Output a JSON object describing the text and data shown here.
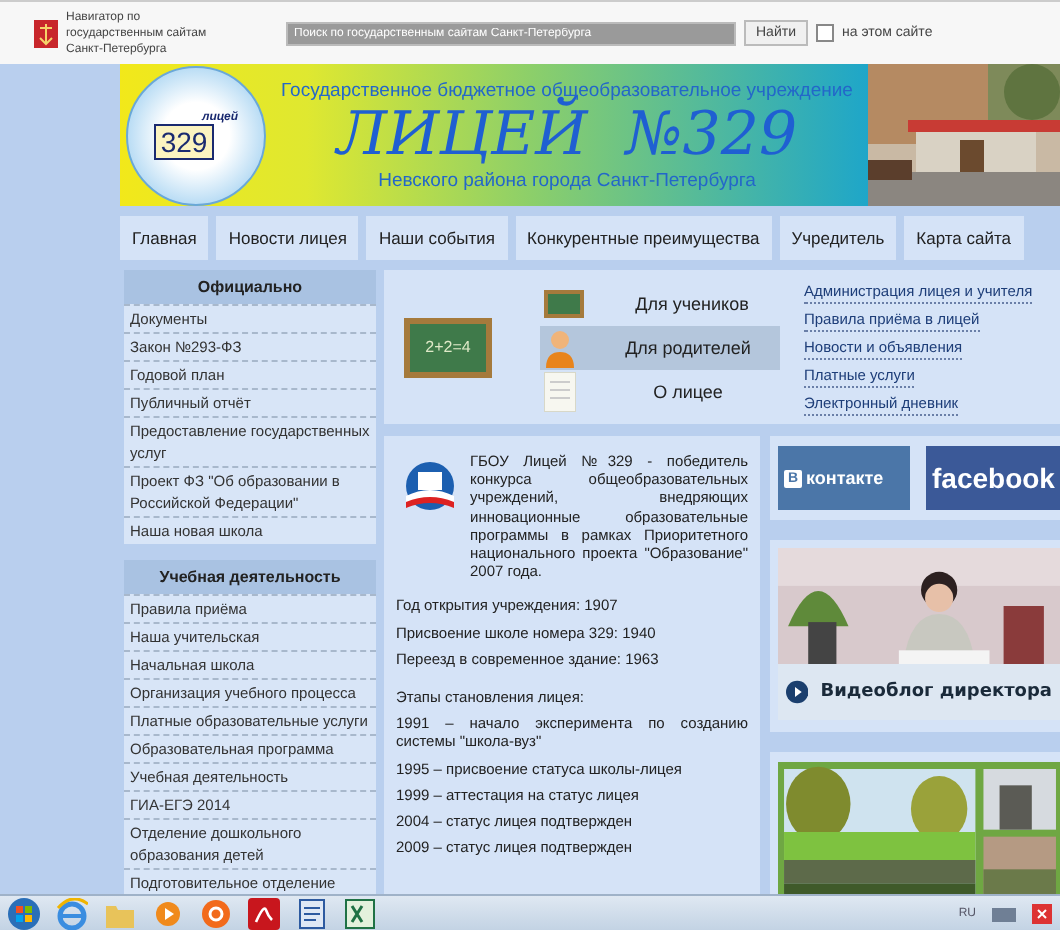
{
  "gov_bar": {
    "navigator_text": "Навигатор по государственным сайтам Санкт-Петербурга",
    "search": {
      "placeholder": "Поиск по государственным сайтам Санкт-Петербурга"
    },
    "search_button": "Найти",
    "site_only": {
      "label": "на этом сайте",
      "checked": false
    }
  },
  "banner": {
    "logo_word": "лицей",
    "logo_number": "329",
    "subtitle": "Государственное бюджетное общеобразовательное учреждение",
    "title": "ЛИЦЕЙ  №329",
    "district": "Невского района города Санкт-Петербурга"
  },
  "nav": [
    {
      "label": "Главная",
      "selected": false
    },
    {
      "label": "Новости лицея",
      "selected": false
    },
    {
      "label": "Наши события",
      "selected": false
    },
    {
      "label": "Конкурентные преимущества",
      "selected": false
    },
    {
      "label": "Учредитель",
      "selected": false
    },
    {
      "label": "Карта сайта",
      "selected": false
    }
  ],
  "sidebar": [
    {
      "heading": "Официально",
      "items": [
        "Документы",
        "Закон №293-ФЗ",
        "Годовой план",
        "Публичный отчёт",
        "Предоставление государственных услуг",
        "Проект ФЗ \"Об образовании в Российской Федерации\"",
        "Наша новая школа"
      ]
    },
    {
      "heading": "Учебная деятельность",
      "items": [
        "Правила приёма",
        "Наша учительская",
        "Начальная школа",
        "Организация учебного процесса",
        "Платные образовательные услуги",
        "Образовательная программа",
        "Учебная деятельность",
        "ГИА-ЕГЭ 2014",
        "Отделение дошкольного образования детей",
        "Подготовительное отделение"
      ]
    }
  ],
  "audience": {
    "board_text": "2+2=4",
    "items": [
      {
        "label": "Для учеников",
        "kind": "pupils",
        "selected": false
      },
      {
        "label": "Для родителей",
        "kind": "parents",
        "selected": true
      },
      {
        "label": "О лицее",
        "kind": "about",
        "selected": false
      }
    ]
  },
  "quick_links": [
    "Администрация лицея и учителя",
    "Правила приёма в лицей",
    "Новости и объявления",
    "Платные услуги",
    "Электронный дневник"
  ],
  "article": {
    "intro": "ГБОУ Лицей №329 - победитель конкурса общеобразовательных учреждений, внедряющих инновационные образовательные программы в рамках Приоритетного национального проекта \"Образование\" 2007 года.",
    "facts": [
      "Год открытия учреждения: 1907",
      "Присвоение школе номера 329: 1940",
      "Переезд в современное здание: 1963"
    ],
    "stages_title": "Этапы становления лицея:",
    "stages": [
      "1991 – начало эксперимента по созданию системы \"школа-вуз\"",
      "1995 – присвоение статуса школы-лицея",
      "1999 – аттестация на статус лицея",
      "2004 – статус лицея подтвержден",
      "2009 – статус лицея подтвержден"
    ]
  },
  "social": {
    "vk_mark": "В",
    "vk_label": "контакте",
    "facebook_label": "facebook"
  },
  "video": {
    "label": "Видеоблог директора"
  },
  "taskbar": {
    "language": "RU"
  }
}
